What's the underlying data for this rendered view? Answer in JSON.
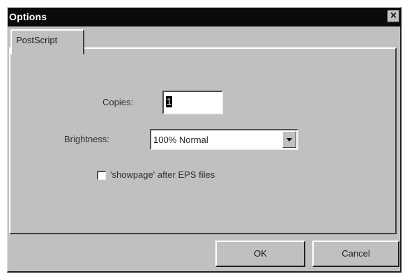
{
  "window": {
    "title": "Options",
    "close_glyph": "×"
  },
  "tabs": [
    {
      "label": "PostScript",
      "selected": true
    }
  ],
  "form": {
    "copies_label": "Copies:",
    "copies_value": "1",
    "brightness_label": "Brightness:",
    "brightness_value": "100% Normal",
    "showpage_label": "'showpage' after EPS files",
    "showpage_checked": false
  },
  "buttons": {
    "ok_label": "OK",
    "cancel_label": "Cancel"
  },
  "icons": {
    "close": "close-icon",
    "dropdown": "chevron-down-icon"
  },
  "colors": {
    "titlebar": "#0b0b0b",
    "face": "#c0c0c0",
    "field": "#ffffff"
  }
}
